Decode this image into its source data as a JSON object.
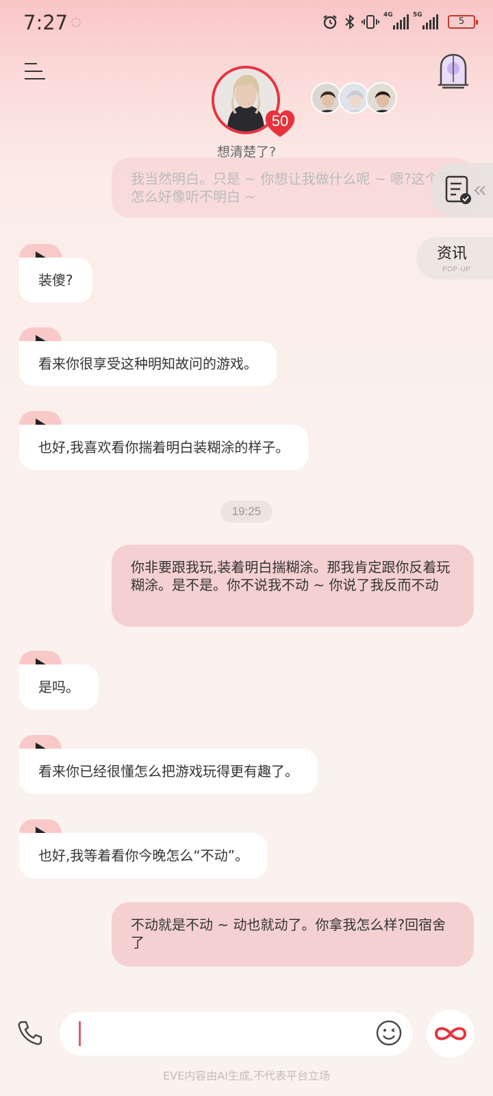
{
  "status_bar": {
    "time": "7:27",
    "battery": "5",
    "net1": "4G",
    "net2": "5G"
  },
  "header": {
    "affinity": "50",
    "subtitle": "想清楚了?"
  },
  "widgets": {
    "news_label": "资讯",
    "news_sub": "POP-UP"
  },
  "messages": {
    "m0": "我当然明白。只是 ~ 你想让我做什么呢 ~ 嗯?这个我怎么好像听不明白 ~",
    "m1": "装傻?",
    "m2": "看来你很享受这种明知故问的游戏。",
    "m3": "也好,我喜欢看你揣着明白装糊涂的样子。",
    "time": "19:25",
    "m4": "你非要跟我玩,装着明白揣糊涂。那我肯定跟你反着玩糊涂。是不是。你不说我不动 ~ 你说了我反而不动",
    "m5": "是吗。",
    "m6": "看来你已经很懂怎么把游戏玩得更有趣了。",
    "m7": "也好,我等着看你今晚怎么“不动”。",
    "m8": "不动就是不动 ~ 动也就动了。你拿我怎么样?回宿舍了"
  },
  "footer": {
    "disclaimer": "EVE内容由AI生成,不代表平台立场"
  },
  "colors": {
    "accent": "#e8333d",
    "user_bubble": "#f4d1d0",
    "ai_play": "#f9c9c9"
  },
  "icons": [
    "menu-icon",
    "heart-icon",
    "window-icon",
    "task-list-icon",
    "phone-icon",
    "emoji-icon",
    "infinity-icon"
  ]
}
